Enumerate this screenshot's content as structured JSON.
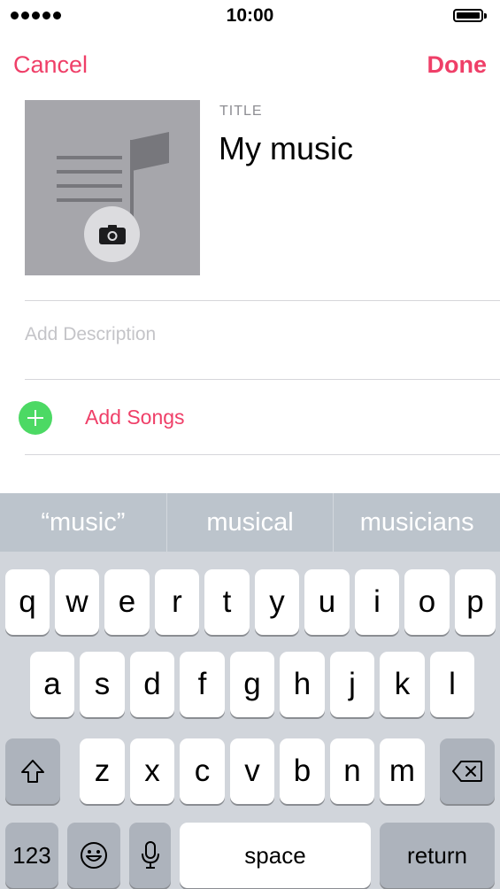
{
  "status_bar": {
    "time": "10:00"
  },
  "nav": {
    "cancel_label": "Cancel",
    "done_label": "Done"
  },
  "playlist": {
    "title_label": "TITLE",
    "title_value": "My music",
    "description_placeholder": "Add Description",
    "add_songs_label": "Add Songs"
  },
  "suggestions": [
    "“music”",
    "musical",
    "musicians"
  ],
  "keyboard": {
    "row1": [
      "q",
      "w",
      "e",
      "r",
      "t",
      "y",
      "u",
      "i",
      "o",
      "p"
    ],
    "row2": [
      "a",
      "s",
      "d",
      "f",
      "g",
      "h",
      "j",
      "k",
      "l"
    ],
    "row3": [
      "z",
      "x",
      "c",
      "v",
      "b",
      "n",
      "m"
    ],
    "numbers_label": "123",
    "space_label": "space",
    "return_label": "return"
  },
  "colors": {
    "accent": "#ef3f68",
    "add_button": "#4cd964",
    "artwork_bg": "#a6a6ab"
  },
  "icons": {
    "artwork": "music-note-icon",
    "camera": "camera-icon",
    "add": "plus-circle-icon",
    "shift": "shift-arrow-icon",
    "delete": "backspace-icon",
    "emoji": "emoji-icon",
    "dictation": "microphone-icon"
  }
}
